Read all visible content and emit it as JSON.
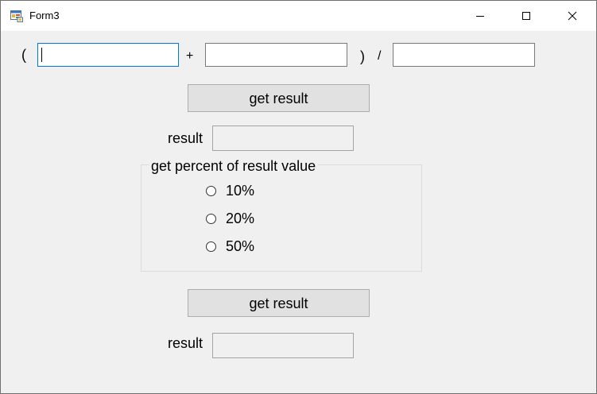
{
  "window": {
    "title": "Form3",
    "controls": {
      "minimize": "minimize",
      "maximize": "maximize",
      "close": "close"
    }
  },
  "formula": {
    "open_paren": "(",
    "plus": "+",
    "close_paren": ")",
    "divide": "/",
    "input_a_value": "",
    "input_b_value": "",
    "input_c_value": ""
  },
  "calc": {
    "button_label": "get result",
    "result_label": "result",
    "result_value": ""
  },
  "percent": {
    "group_title": "get percent of result value",
    "options": [
      {
        "label": "10%",
        "selected": false
      },
      {
        "label": "20%",
        "selected": false
      },
      {
        "label": "50%",
        "selected": false
      }
    ],
    "button_label": "get result",
    "result_label": "result",
    "result_value": ""
  },
  "colors": {
    "focus_border": "#0078d7",
    "window_bg": "#f0f0f0"
  }
}
